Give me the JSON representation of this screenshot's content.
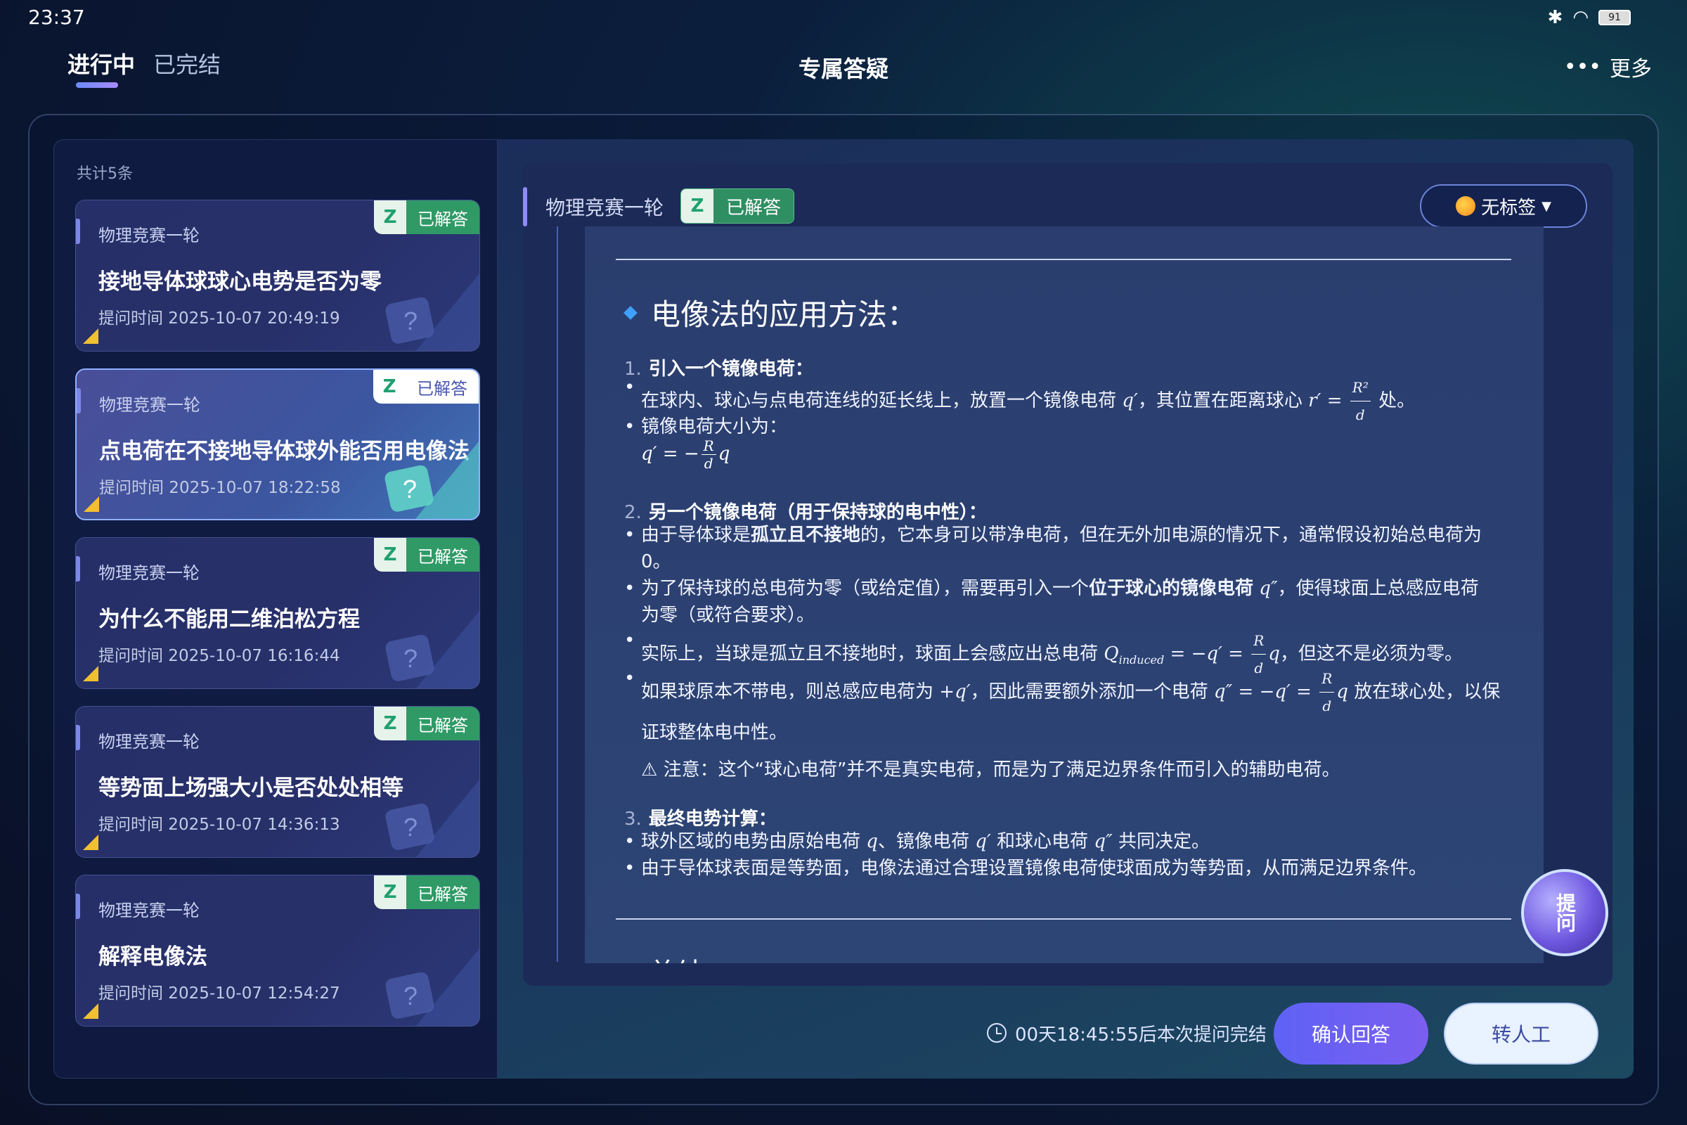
{
  "status_bar": {
    "time": "23:37",
    "battery": "91"
  },
  "nav": {
    "tabs": [
      {
        "label": "进行中",
        "active": true
      },
      {
        "label": "已完结",
        "active": false
      }
    ],
    "title": "专属答疑",
    "more": "更多"
  },
  "list": {
    "count": "共计5条",
    "items": [
      {
        "subject": "物理竞赛一轮",
        "badge_z": "Z",
        "badge": "已解答",
        "title": "接地导体球球心电势是否为零",
        "time": "提问时间 2025-10-07 20:49:19"
      },
      {
        "subject": "物理竞赛一轮",
        "badge_z": "Z",
        "badge": "已解答",
        "title": "点电荷在不接地导体球外能否用电像法",
        "time": "提问时间 2025-10-07 18:22:58"
      },
      {
        "subject": "物理竞赛一轮",
        "badge_z": "Z",
        "badge": "已解答",
        "title": "为什么不能用二维泊松方程",
        "time": "提问时间 2025-10-07 16:16:44"
      },
      {
        "subject": "物理竞赛一轮",
        "badge_z": "Z",
        "badge": "已解答",
        "title": "等势面上场强大小是否处处相等",
        "time": "提问时间 2025-10-07 14:36:13"
      },
      {
        "subject": "物理竞赛一轮",
        "badge_z": "Z",
        "badge": "已解答",
        "title": "解释电像法",
        "time": "提问时间 2025-10-07 12:54:27"
      }
    ]
  },
  "answer": {
    "subject": "物理竞赛一轮",
    "badge_z": "Z",
    "badge": "已解答",
    "tag": "无标签",
    "heading": "电像法的应用方法：",
    "step1": {
      "num": "1.",
      "title": "引入一个镜像电荷：",
      "b1_a": "在球内、球心与点电荷连线的延长线上，放置一个镜像电荷",
      "b1_b": "，其位置在距离球心",
      "b1_c": "处。",
      "b2": "镜像电荷大小为："
    },
    "step2": {
      "num": "2.",
      "title": "另一个镜像电荷（用于保持球的电中性）：",
      "b1_a": "由于导体球是",
      "b1_bold": "孤立且不接地",
      "b1_b": "的，它本身可以带净电荷，但在无外加电源的情况下，通常假设初始总电荷为",
      "b1_c": "0。",
      "b2_a": "为了保持球的总电荷为零（或给定值），需要再引入一个",
      "b2_bold": "位于球心的镜像电荷",
      "b2_b": "，使得球面上总感应电荷",
      "b2_c": "为零（或符合要求）。",
      "b3_a": "实际上，当球是孤立且不接地时，球面上会感应出总电荷",
      "b3_b": "，但这不是必须为零。",
      "b4_a": "如果球原本不带电，则总感应电荷为",
      "b4_b": "，因此需要额外添加一个电荷",
      "b4_c": "放在球心处，以保",
      "b4_d": "证球整体电中性。"
    },
    "note": "⚠ 注意：这个“球心电荷”并不是真实电荷，而是为了满足边界条件而引入的辅助电荷。",
    "step3": {
      "num": "3.",
      "title": "最终电势计算：",
      "b1_a": "球外区域的电势由原始电荷",
      "b1_b": "、镜像电荷",
      "b1_c": "和球心电荷",
      "b1_d": "共同决定。",
      "b2": "由于导体球表面是等势面，电像法通过合理设置镜像电荷使球面成为等势面，从而满足边界条件。"
    },
    "next_heading": "总结"
  },
  "ask_button": "提问",
  "footer": {
    "countdown": "00天18:45:55后本次提问完结",
    "confirm": "确认回答",
    "human": "转人工"
  }
}
